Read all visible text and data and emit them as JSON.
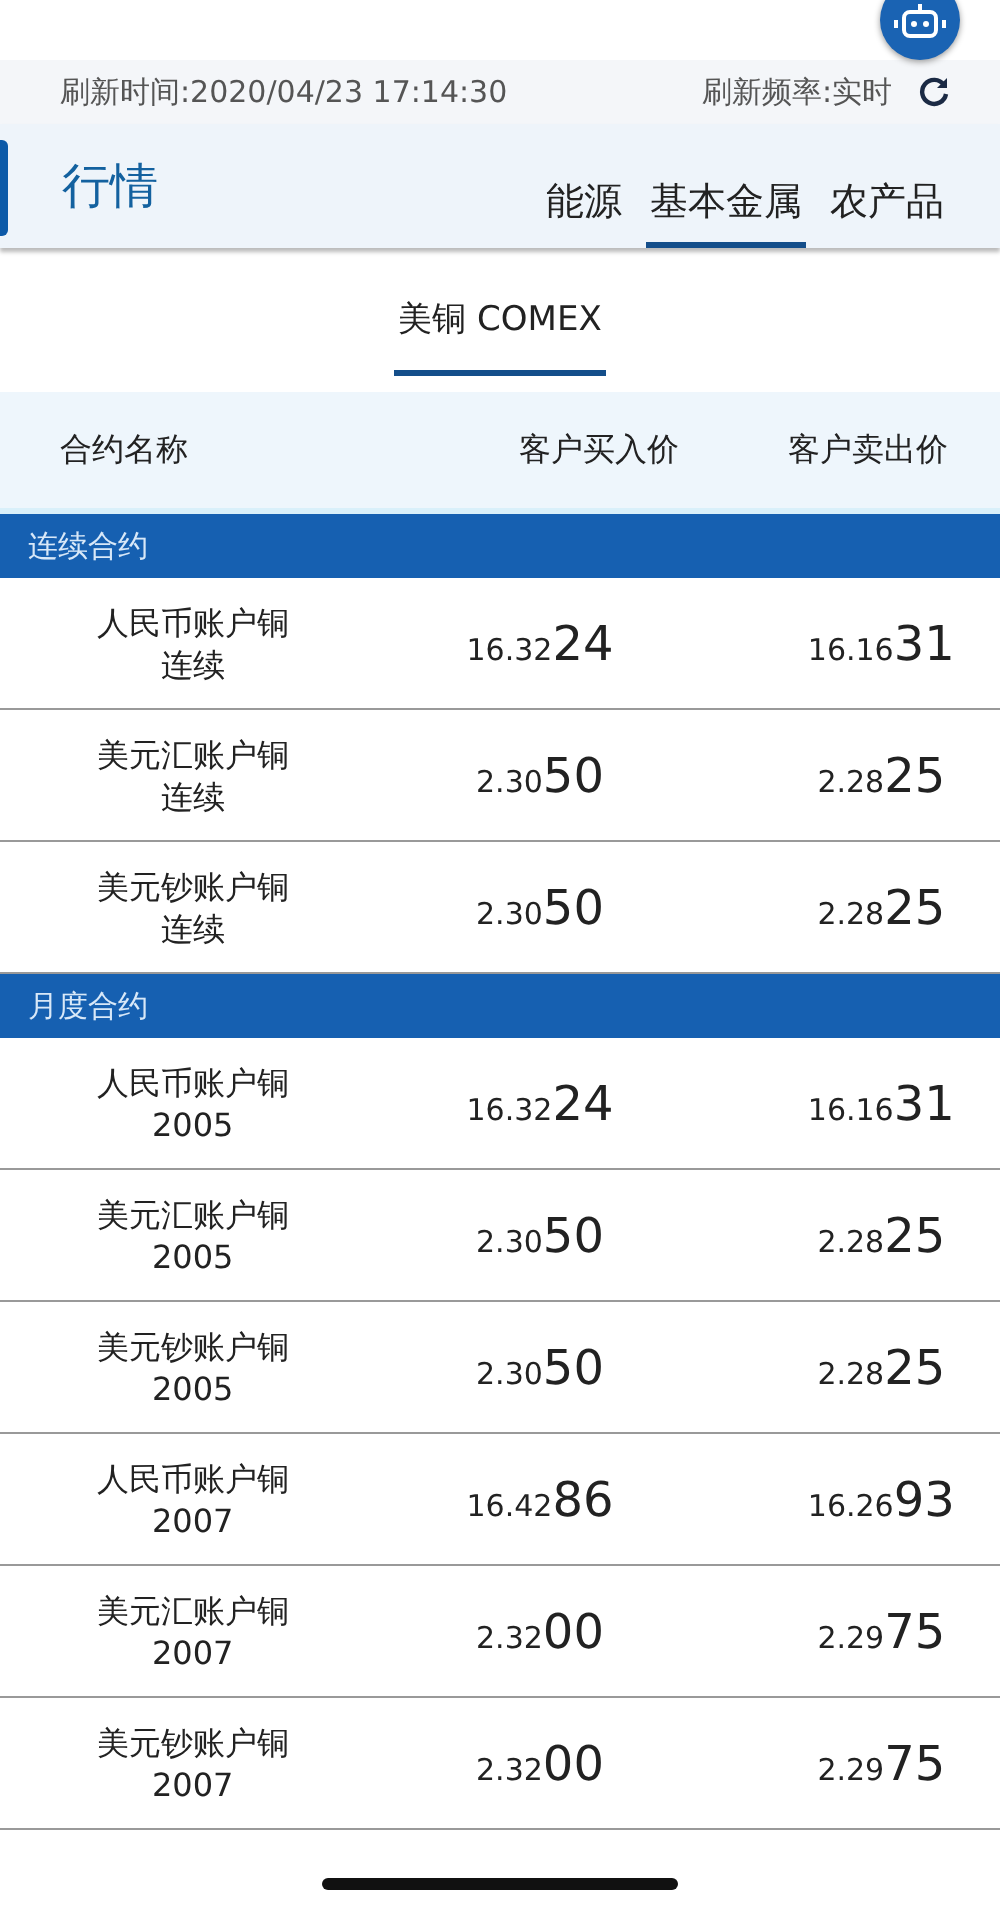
{
  "refresh": {
    "time": "刷新时间:2020/04/23 17:14:30",
    "rate": "刷新频率:实时"
  },
  "header": {
    "title": "行情",
    "tabs": [
      {
        "label": "能源",
        "selected": false
      },
      {
        "label": "基本金属",
        "selected": true
      },
      {
        "label": "农产品",
        "selected": false
      }
    ]
  },
  "subtabs": [
    {
      "label": "美铜 COMEX",
      "selected": true
    }
  ],
  "table": {
    "columns": [
      "合约名称",
      "客户买入价",
      "客户卖出价"
    ],
    "sections": [
      {
        "title": "连续合约",
        "rows": [
          {
            "name": "人民币账户铜",
            "term": "连续",
            "buy": {
              "lead": "16.32",
              "tail": "24"
            },
            "sell": {
              "lead": "16.16",
              "tail": "31"
            }
          },
          {
            "name": "美元汇账户铜",
            "term": "连续",
            "buy": {
              "lead": "2.30",
              "tail": "50"
            },
            "sell": {
              "lead": "2.28",
              "tail": "25"
            }
          },
          {
            "name": "美元钞账户铜",
            "term": "连续",
            "buy": {
              "lead": "2.30",
              "tail": "50"
            },
            "sell": {
              "lead": "2.28",
              "tail": "25"
            }
          }
        ]
      },
      {
        "title": "月度合约",
        "rows": [
          {
            "name": "人民币账户铜",
            "term": "2005",
            "buy": {
              "lead": "16.32",
              "tail": "24"
            },
            "sell": {
              "lead": "16.16",
              "tail": "31"
            }
          },
          {
            "name": "美元汇账户铜",
            "term": "2005",
            "buy": {
              "lead": "2.30",
              "tail": "50"
            },
            "sell": {
              "lead": "2.28",
              "tail": "25"
            }
          },
          {
            "name": "美元钞账户铜",
            "term": "2005",
            "buy": {
              "lead": "2.30",
              "tail": "50"
            },
            "sell": {
              "lead": "2.28",
              "tail": "25"
            }
          },
          {
            "name": "人民币账户铜",
            "term": "2007",
            "buy": {
              "lead": "16.42",
              "tail": "86"
            },
            "sell": {
              "lead": "16.26",
              "tail": "93"
            }
          },
          {
            "name": "美元汇账户铜",
            "term": "2007",
            "buy": {
              "lead": "2.32",
              "tail": "00"
            },
            "sell": {
              "lead": "2.29",
              "tail": "75"
            }
          },
          {
            "name": "美元钞账户铜",
            "term": "2007",
            "buy": {
              "lead": "2.32",
              "tail": "00"
            },
            "sell": {
              "lead": "2.29",
              "tail": "75"
            }
          }
        ]
      }
    ]
  }
}
